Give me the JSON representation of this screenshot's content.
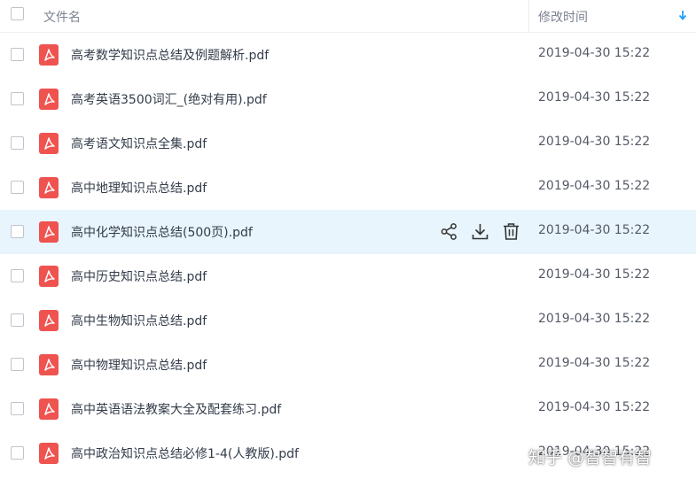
{
  "header": {
    "name_col": "文件名",
    "time_col": "修改时间"
  },
  "colors": {
    "pdf_red": "#ef5350",
    "accent_blue": "#1e9fff",
    "hover_row": "#e8f5fc"
  },
  "files": [
    {
      "name": "高考数学知识点总结及例题解析.pdf",
      "time": "2019-04-30 15:22"
    },
    {
      "name": "高考英语3500词汇_(绝对有用).pdf",
      "time": "2019-04-30 15:22"
    },
    {
      "name": "高考语文知识点全集.pdf",
      "time": "2019-04-30 15:22"
    },
    {
      "name": "高中地理知识点总结.pdf",
      "time": "2019-04-30 15:22"
    },
    {
      "name": "高中化学知识点总结(500页).pdf",
      "time": "2019-04-30 15:22",
      "hovered": true
    },
    {
      "name": "高中历史知识点总结.pdf",
      "time": "2019-04-30 15:22"
    },
    {
      "name": "高中生物知识点总结.pdf",
      "time": "2019-04-30 15:22"
    },
    {
      "name": "高中物理知识点总结.pdf",
      "time": "2019-04-30 15:22"
    },
    {
      "name": "高中英语语法教案大全及配套练习.pdf",
      "time": "2019-04-30 15:22"
    },
    {
      "name": "高中政治知识点总结必修1-4(人教版).pdf",
      "time": "2019-04-30 15:22"
    }
  ],
  "row_actions": [
    "share-icon",
    "download-icon",
    "delete-icon"
  ],
  "watermark": "知乎 @智智有智"
}
